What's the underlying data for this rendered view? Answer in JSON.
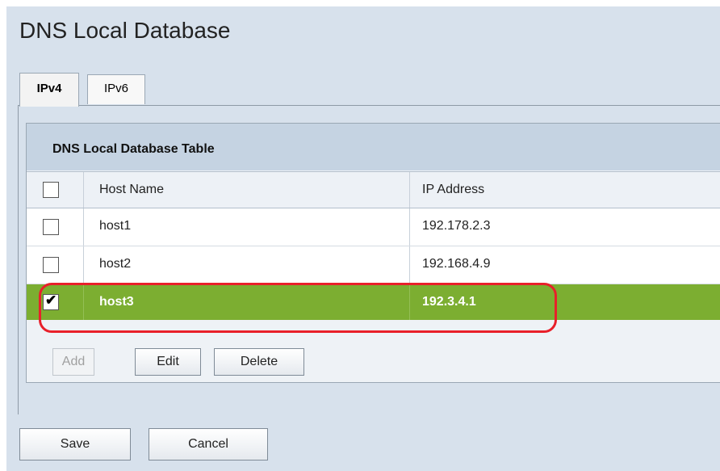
{
  "page": {
    "title": "DNS Local Database"
  },
  "tabs": [
    {
      "label": "IPv4",
      "active": true
    },
    {
      "label": "IPv6",
      "active": false
    }
  ],
  "table": {
    "title": "DNS Local Database Table",
    "columns": [
      "Host Name",
      "IP Address"
    ],
    "rows": [
      {
        "host": "host1",
        "ip": "192.178.2.3",
        "checked": false
      },
      {
        "host": "host2",
        "ip": "192.168.4.9",
        "checked": false
      },
      {
        "host": "host3",
        "ip": "192.3.4.1",
        "checked": true
      }
    ],
    "buttons": {
      "add": "Add",
      "edit": "Edit",
      "delete": "Delete"
    }
  },
  "footer": {
    "save": "Save",
    "cancel": "Cancel"
  },
  "colors": {
    "selected_row": "#7cae31",
    "highlight_outline": "#e8202a",
    "page_background": "#d7e1ec"
  }
}
